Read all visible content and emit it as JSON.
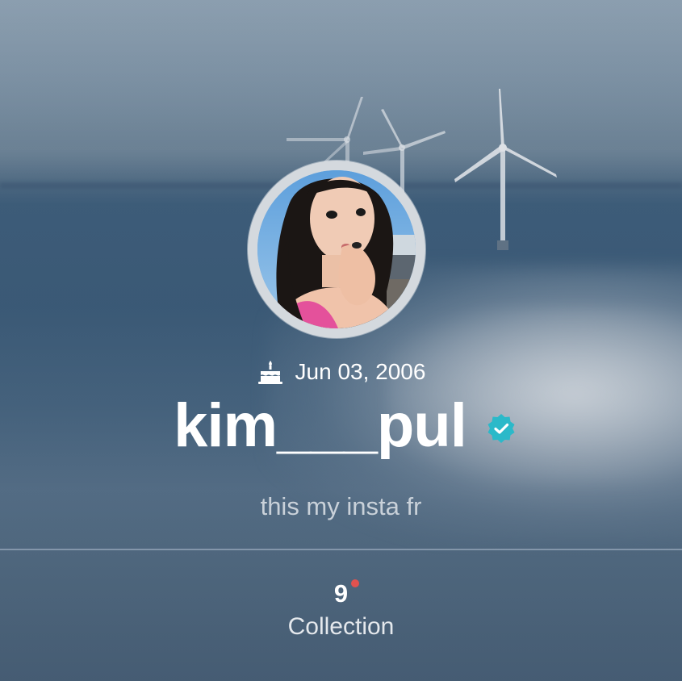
{
  "profile": {
    "birthday": "Jun 03, 2006",
    "username": "kim___pul",
    "verified": true,
    "bio": "this my insta fr"
  },
  "stats": {
    "collection_count": "9",
    "collection_label": "Collection",
    "has_new_indicator": true
  },
  "colors": {
    "verified_badge": "#2bb9c9",
    "new_dot": "#e0524f",
    "text_primary": "#ffffff",
    "text_muted": "#c9d1d9"
  },
  "icons": {
    "birthday": "cake-icon",
    "verified": "verified-badge-icon"
  }
}
